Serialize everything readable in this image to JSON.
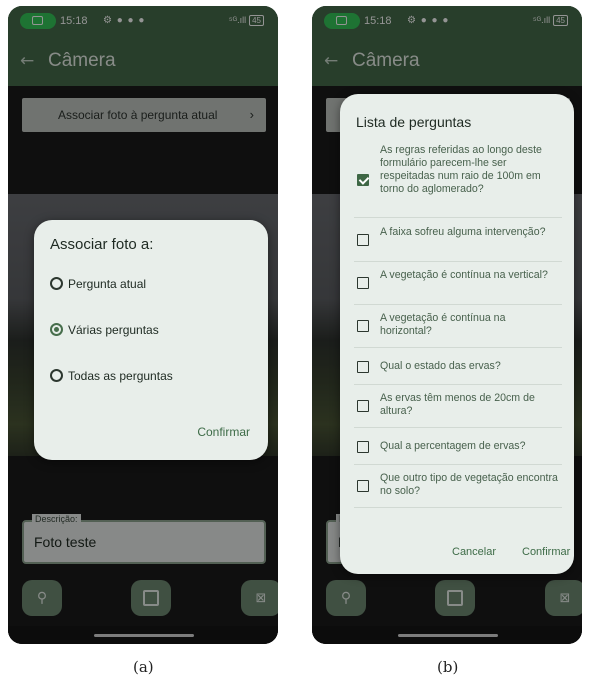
{
  "status_bar": {
    "time": "15:18",
    "battery": "45",
    "signal_text": "⁵ᴳ.ıll"
  },
  "app_bar": {
    "title": "Câmera"
  },
  "associate_button": {
    "label": "Associar foto à pergunta atual",
    "chevron": "›"
  },
  "description": {
    "label": "Descrição:",
    "value": "Foto teste"
  },
  "action_icons": [
    "location-pin-icon",
    "save-icon",
    "delete-icon"
  ],
  "dialog_a": {
    "title": "Associar foto a:",
    "options": [
      {
        "label": "Pergunta atual",
        "selected": false
      },
      {
        "label": "Várias perguntas",
        "selected": true
      },
      {
        "label": "Todas as perguntas",
        "selected": false
      }
    ],
    "confirm_label": "Confirmar"
  },
  "dialog_b": {
    "title": "Lista de perguntas",
    "questions": [
      {
        "text": "As regras referidas ao longo deste formulário parecem-lhe ser respeitadas num raio de 100m em torno do aglomerado?",
        "checked": true
      },
      {
        "text": "A faixa sofreu alguma intervenção?",
        "checked": false
      },
      {
        "text": "A vegetação é contínua na vertical?",
        "checked": false
      },
      {
        "text": "A vegetação é contínua na horizontal?",
        "checked": false
      },
      {
        "text": "Qual o estado das ervas?",
        "checked": false
      },
      {
        "text": "As ervas têm menos de 20cm de altura?",
        "checked": false
      },
      {
        "text": "Qual a percentagem de ervas?",
        "checked": false
      },
      {
        "text": "Que outro tipo de vegetação encontra no solo?",
        "checked": false
      }
    ],
    "cancel_label": "Cancelar",
    "confirm_label": "Confirmar"
  },
  "captions": {
    "a": "(a)",
    "b": "(b)"
  },
  "colors": {
    "app_bar": "#456b4a",
    "accent": "#3d6b47",
    "dialog_bg": "#e8eeea",
    "fab": "#6f8a73"
  }
}
